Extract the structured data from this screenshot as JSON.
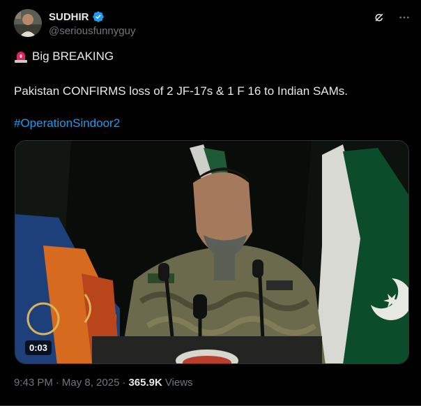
{
  "author": {
    "name": "SUDHIR",
    "handle": "@seriousfunnyguy",
    "verified": true,
    "verified_color": "#1d9bf0"
  },
  "top_actions": [
    {
      "icon": "grok-icon"
    },
    {
      "icon": "more-icon",
      "label": "···"
    }
  ],
  "tweet": {
    "line1_icon": "siren-icon",
    "line1": "Big BREAKING",
    "line2": "Pakistan CONFIRMS loss of 2 JF-17s & 1 F 16 to Indian SAMs.",
    "hashtag": "#OperationSindoor2",
    "hashtag_color": "#1d9bf0"
  },
  "media": {
    "type": "video",
    "duration": "0:03"
  },
  "meta": {
    "time": "9:43 PM",
    "separator1": "·",
    "date": "May 8, 2025",
    "separator2": "·",
    "views_count": "365.9K",
    "views_label": "Views"
  }
}
